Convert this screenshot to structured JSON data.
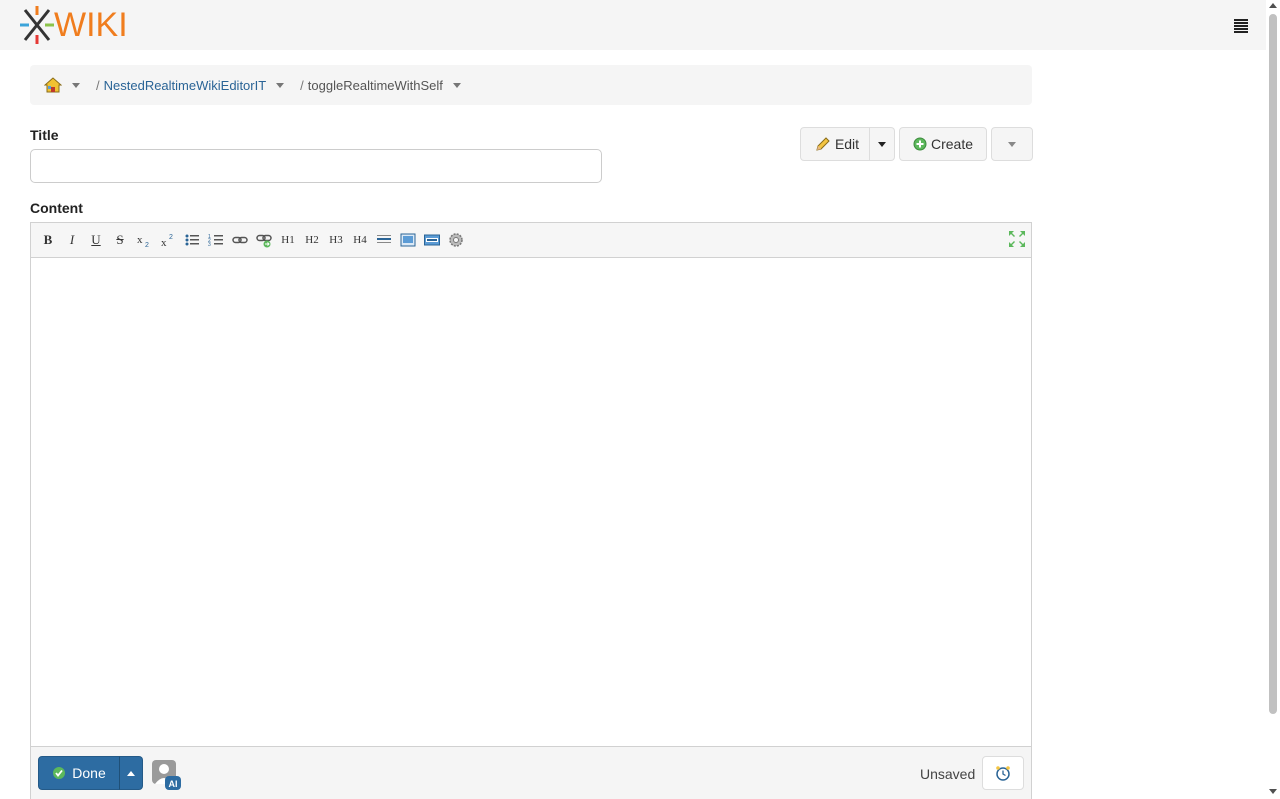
{
  "app": {
    "logo_text": "WIKI"
  },
  "breadcrumb": {
    "items": [
      {
        "label": "NestedRealtimeWikiEditorIT"
      },
      {
        "label": "toggleRealtimeWithSelf"
      }
    ],
    "separator": "/"
  },
  "form": {
    "title_label": "Title",
    "title_value": "",
    "content_label": "Content"
  },
  "page_actions": {
    "edit_label": "Edit",
    "create_label": "Create"
  },
  "toolbar": {
    "buttons": [
      "bold",
      "italic",
      "underline",
      "strikethrough",
      "subscript",
      "superscript",
      "bulleted-list",
      "numbered-list",
      "link",
      "unlink",
      "h1",
      "h2",
      "h3",
      "h4",
      "horizontal-rule",
      "image",
      "html",
      "macro"
    ],
    "h1": "H1",
    "h2": "H2",
    "h3": "H3",
    "h4": "H4",
    "b": "B",
    "i": "I",
    "u": "U",
    "s": "S"
  },
  "footer": {
    "done_label": "Done",
    "user_initials": "AI",
    "save_status": "Unsaved"
  },
  "colors": {
    "brand_orange": "#f07d1e",
    "primary_blue": "#2d6ca2",
    "link_blue": "#2a6496"
  }
}
